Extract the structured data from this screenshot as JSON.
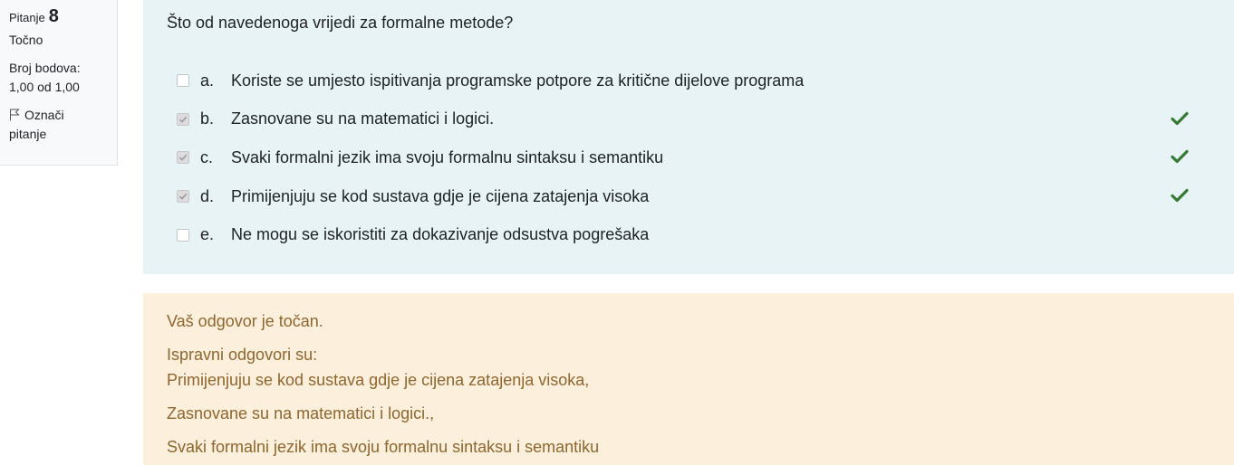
{
  "info": {
    "question_label": "Pitanje",
    "question_number": "8",
    "state": "Točno",
    "grade_label": "Broj bodova:",
    "grade_value": "1,00 od 1,00",
    "flag_label_1": "Označi",
    "flag_label_2": "pitanje"
  },
  "question": {
    "text": "Što od navedenoga vrijedi za formalne metode?",
    "answers": [
      {
        "letter": "a.",
        "text": "Koriste se umjesto ispitivanja programske potpore za kritične dijelove programa",
        "checked": false,
        "correct": false
      },
      {
        "letter": "b.",
        "text": "Zasnovane su na matematici i logici.",
        "checked": true,
        "correct": true
      },
      {
        "letter": "c.",
        "text": "Svaki formalni jezik ima svoju formalnu sintaksu i semantiku",
        "checked": true,
        "correct": true
      },
      {
        "letter": "d.",
        "text": "Primijenjuju se kod sustava gdje je cijena zatajenja visoka",
        "checked": true,
        "correct": true
      },
      {
        "letter": "e.",
        "text": "Ne mogu se iskoristiti za dokazivanje odsustva pogrešaka",
        "checked": false,
        "correct": false
      }
    ]
  },
  "feedback": {
    "general": "Vaš odgovor je točan.",
    "right_answers_label": "Ispravni odgovori su:",
    "right_answers": [
      "Primijenjuju se kod sustava gdje je cijena zatajenja visoka,",
      "Zasnovane su na matematici i logici.,",
      "Svaki formalni jezik ima svoju formalnu sintaksu i semantiku"
    ]
  },
  "colors": {
    "question_bg": "#e7f3f5",
    "feedback_bg": "#fcefdc",
    "feedback_text": "#8e662e",
    "correct_tick": "#357a32"
  }
}
